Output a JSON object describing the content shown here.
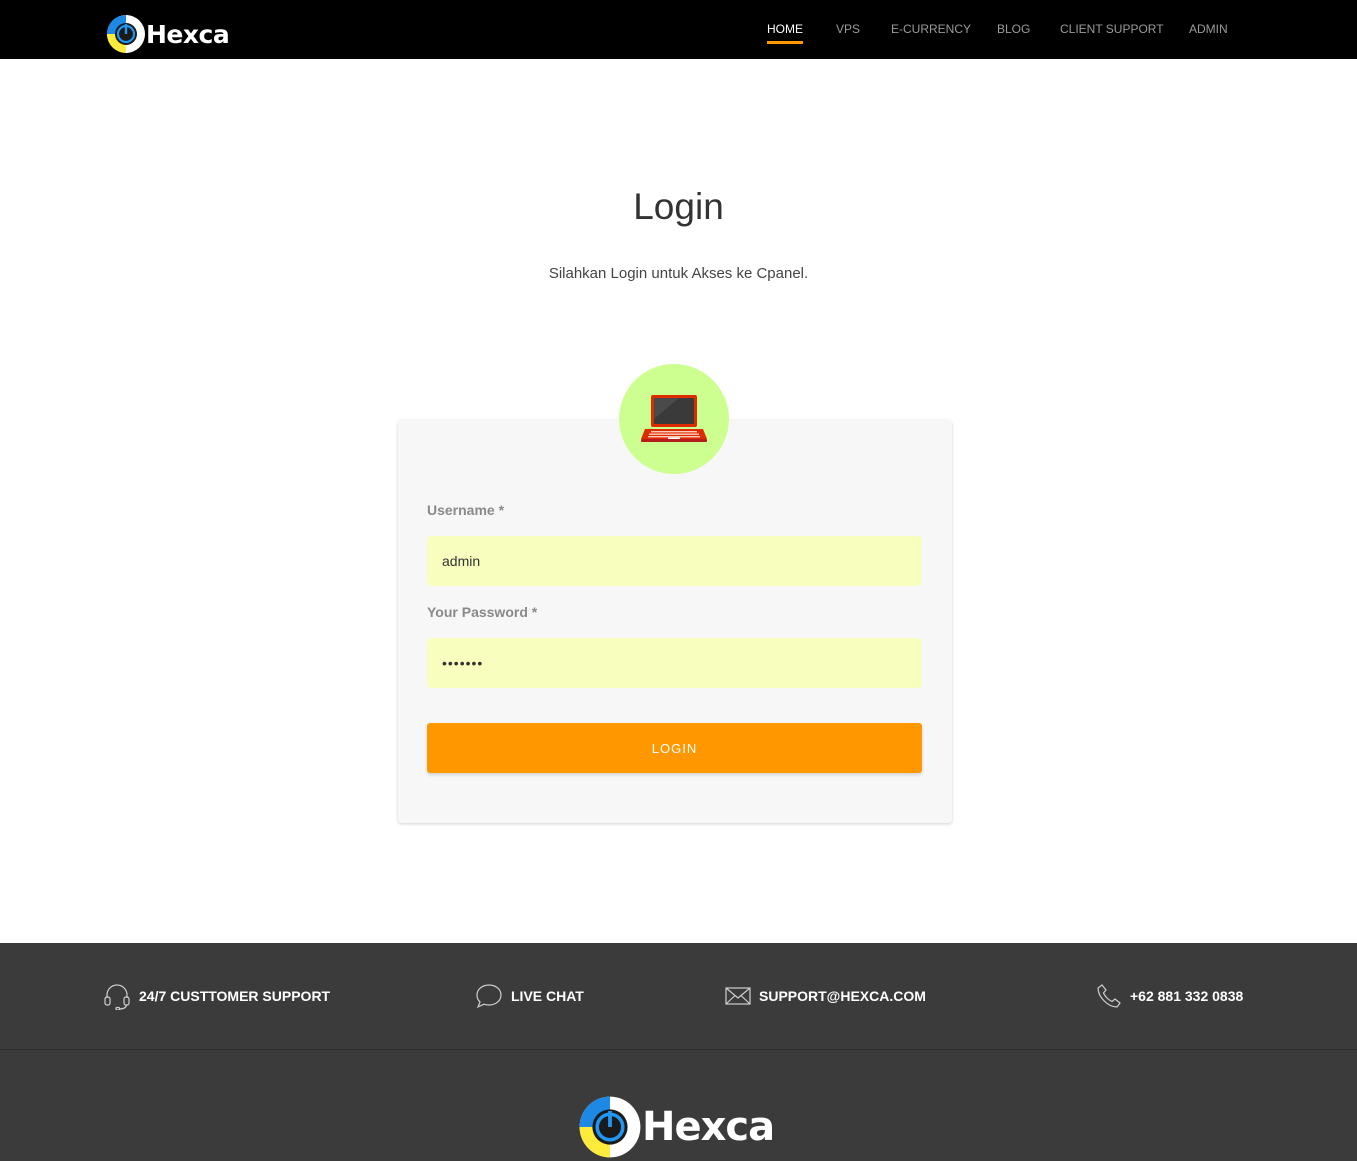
{
  "header": {
    "brand": "Hexca",
    "nav": [
      {
        "label": "HOME",
        "active": true
      },
      {
        "label": "VPS",
        "active": false
      },
      {
        "label": "E-CURRENCY",
        "active": false
      },
      {
        "label": "BLOG",
        "active": false
      },
      {
        "label": "CLIENT SUPPORT",
        "active": false
      },
      {
        "label": "ADMIN",
        "active": false
      }
    ]
  },
  "main": {
    "title": "Login",
    "subtitle": "Silahkan Login untuk Akses ke Cpanel.",
    "avatar_icon": "laptop-icon",
    "form": {
      "username_label": "Username *",
      "username_value": "admin",
      "password_label": "Your Password *",
      "password_value": "•••••••",
      "submit_label": "LOGIN"
    }
  },
  "footer": {
    "contacts": [
      {
        "icon": "headset-icon",
        "label": "24/7 CUSTTOMER SUPPORT"
      },
      {
        "icon": "chat-bubble-icon",
        "label": "LIVE CHAT"
      },
      {
        "icon": "envelope-icon",
        "label": "SUPPORT@HEXCA.COM"
      },
      {
        "icon": "phone-icon",
        "label": "+62 881 332 0838"
      }
    ],
    "brand": "Hexca"
  },
  "colors": {
    "accent": "#ff9800",
    "nav_bg": "#000000",
    "footer_bg": "#3b3b3b",
    "input_bg": "#f8ffbe",
    "avatar_bg": "#ccff90"
  }
}
